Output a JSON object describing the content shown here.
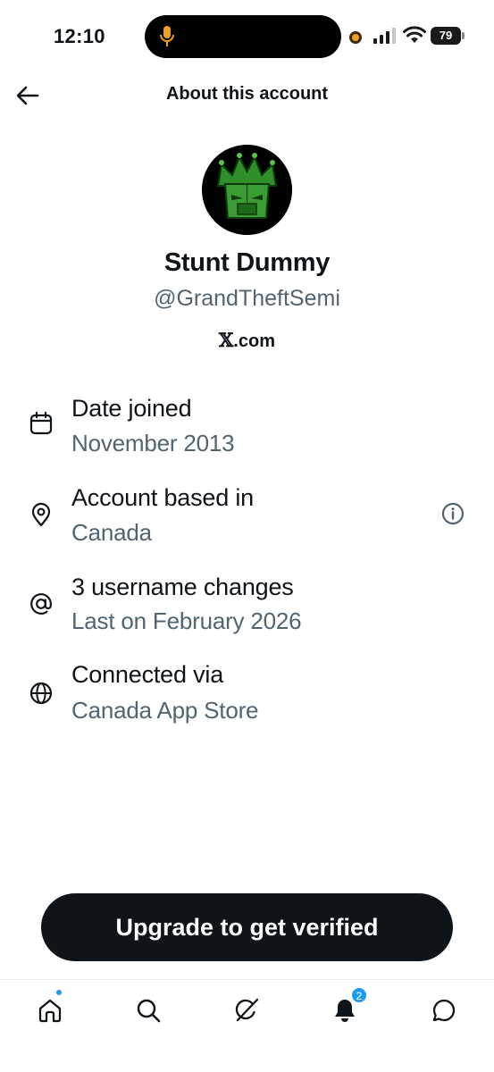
{
  "status_bar": {
    "time": "12:10",
    "battery": "79"
  },
  "header": {
    "back_icon": "arrow-left-icon",
    "title": "About this account"
  },
  "profile": {
    "name": "Stunt Dummy",
    "handle": "@GrandTheftSemi",
    "source": ".com",
    "source_mark": "𝕏"
  },
  "info": [
    {
      "icon": "calendar-icon",
      "title": "Date joined",
      "subtitle": "November 2013"
    },
    {
      "icon": "location-pin-icon",
      "title": "Account based in",
      "subtitle": "Canada",
      "action_icon": "info-icon"
    },
    {
      "icon": "at-sign-icon",
      "title": "3 username changes",
      "subtitle": "Last on February 2026"
    },
    {
      "icon": "globe-icon",
      "title": "Connected via",
      "subtitle": "Canada App Store"
    }
  ],
  "upgrade_button": "Upgrade to get verified",
  "tabbar": {
    "items": [
      "home-icon",
      "search-icon",
      "grok-icon",
      "notifications-icon",
      "messages-icon"
    ],
    "notifications_badge": "2"
  },
  "colors": {
    "text": "#0f1419",
    "secondary": "#536471",
    "accent": "#1d9bf0"
  }
}
